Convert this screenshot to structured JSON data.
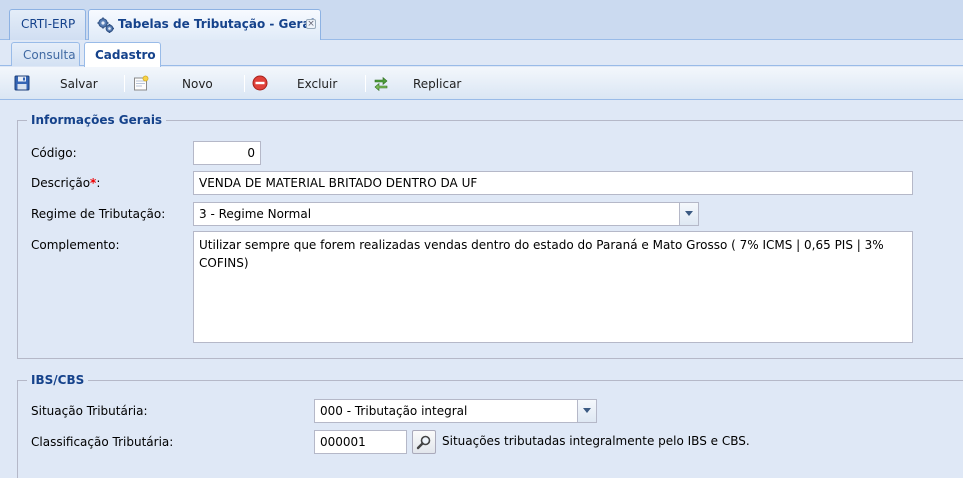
{
  "top_tabs": [
    {
      "label": "CRTI-ERP"
    },
    {
      "label": "Tabelas de Tributação - Geral"
    }
  ],
  "sub_tabs": [
    {
      "label": "Consulta"
    },
    {
      "label": "Cadastro"
    }
  ],
  "toolbar": {
    "save_label": "Salvar",
    "new_label": "Novo",
    "delete_label": "Excluir",
    "replicate_label": "Replicar"
  },
  "gerais": {
    "legend": "Informações Gerais",
    "codigo_label": "Código:",
    "codigo_value": "0",
    "descricao_label": "Descrição",
    "descricao_required": "*",
    "descricao_suffix": ":",
    "descricao_value": "VENDA DE MATERIAL BRITADO DENTRO DA UF",
    "regime_label": "Regime de Tributação:",
    "regime_value": "3 - Regime Normal",
    "complemento_label": "Complemento:",
    "complemento_value": "Utilizar sempre que forem realizadas vendas dentro do estado do Paraná e Mato Grosso ( 7% ICMS | 0,65 PIS | 3% COFINS)"
  },
  "ibs": {
    "legend": "IBS/CBS",
    "situacao_label": "Situação Tributária:",
    "situacao_value": "000 - Tributação integral",
    "classificacao_label": "Classificação Tributária:",
    "classificacao_value": "000001",
    "classificacao_desc": "Situações tributadas integralmente pelo IBS e CBS."
  },
  "colors": {
    "accent": "#15428b",
    "background": "#dfe8f6",
    "border": "#99bbe8",
    "required": "#ee0000"
  }
}
